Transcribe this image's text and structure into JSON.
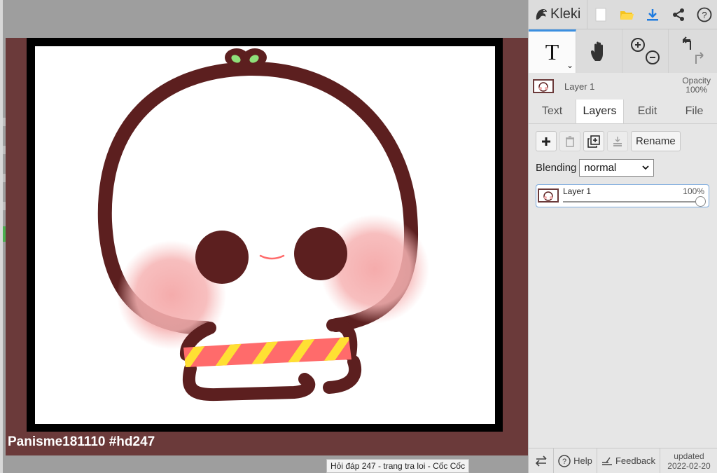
{
  "app": {
    "name": "Kleki"
  },
  "canvas": {
    "watermark": "Panisme181110 #hd247",
    "status_tooltip": "Hỏi đáp 247 - trang tra loi - Cốc Cốc"
  },
  "topbar": {
    "icons": [
      "new-image-icon",
      "open-folder-icon",
      "download-icon",
      "share-icon",
      "help-icon"
    ]
  },
  "tools": {
    "text_tool_glyph": "T",
    "chevron": "⌄",
    "hand_tool": "hand-icon",
    "zoom": [
      "zoom-in-icon",
      "zoom-out-icon"
    ],
    "history": [
      "undo-icon",
      "redo-icon"
    ]
  },
  "layer_strip": {
    "label": "Layer 1",
    "opacity_label": "Opacity",
    "opacity_value": "100%"
  },
  "tabs": [
    {
      "label": "Text",
      "active": false
    },
    {
      "label": "Layers",
      "active": true
    },
    {
      "label": "Edit",
      "active": false
    },
    {
      "label": "File",
      "active": false
    }
  ],
  "layers_panel": {
    "rename_label": "Rename",
    "blending_label": "Blending",
    "blending_value": "normal",
    "layers": [
      {
        "name": "Layer 1",
        "opacity": "100%",
        "opacity_fraction": 1.0
      }
    ]
  },
  "footer": {
    "help_label": "Help",
    "feedback_label": "Feedback",
    "updated_label": "updated",
    "updated_date": "2022-02-20"
  },
  "colors": {
    "accent": "#3b8fe0",
    "artboard": "#6b3a3a",
    "outline": "#5c1f1f",
    "blush": "#f7b0b0",
    "stripe_red": "#ff6b6b",
    "stripe_yellow": "#ffe033",
    "leaf": "#8fe07a"
  }
}
